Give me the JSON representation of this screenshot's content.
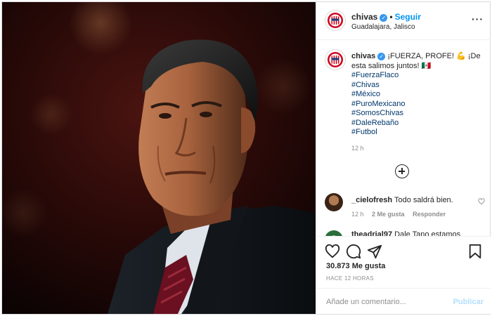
{
  "account": {
    "username": "chivas",
    "follow_label": "Seguir",
    "location": "Guadalajara, Jalisco",
    "more_label": "···"
  },
  "caption": {
    "username": "chivas",
    "text": "¡FUERZA, PROFE! 💪 ¡De esta salimos juntos! 🇲🇽",
    "hashtags": [
      "#FuerzaFlaco",
      "#Chivas",
      "#México",
      "#PuroMexicano",
      "#SomosChivas",
      "#DaleRebaño",
      "#Futbol"
    ],
    "time": "12 h"
  },
  "comments": [
    {
      "username": "_cielofresh",
      "text": "Todo saldrá bien.",
      "time": "12 h",
      "likes": "2 Me gusta",
      "reply_label": "Responder"
    },
    {
      "username": "theadrial97",
      "text": "Dale Tano estamos"
    }
  ],
  "engagement": {
    "likes_count": "30.873",
    "likes_label": "Me gusta",
    "time_ago": "HACE 12 HORAS"
  },
  "composer": {
    "placeholder": "Añade un comentario...",
    "submit_label": "Publicar"
  },
  "icons": {
    "like": "heart-icon",
    "comment": "comment-icon",
    "share": "share-icon",
    "save": "bookmark-icon",
    "verified": "verified-badge-icon",
    "load_more": "plus-circle-icon"
  },
  "colors": {
    "link": "#0095f6",
    "hashtag": "#00376b",
    "verified": "#3897f0",
    "muted": "#8e8e8e",
    "publish_disabled": "#b2dffc"
  }
}
